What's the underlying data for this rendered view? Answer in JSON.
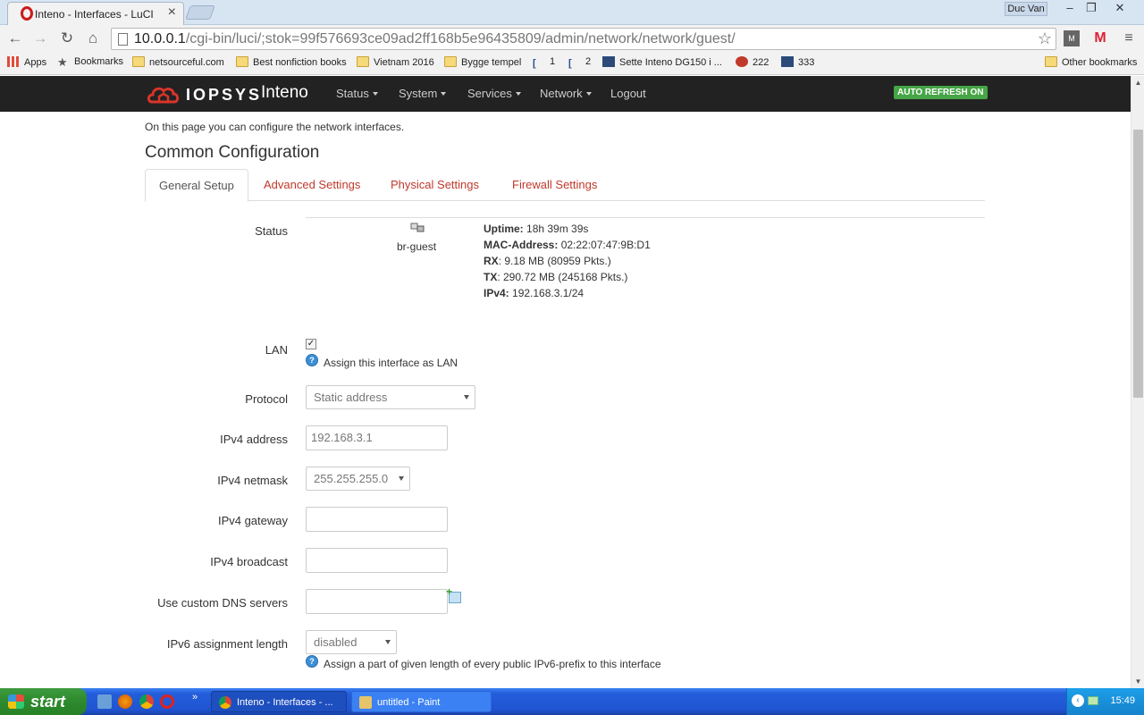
{
  "browser": {
    "tab_title": "Inteno - Interfaces - LuCI",
    "user_name": "Duc Van",
    "url_host": "10.0.0.1",
    "url_path": "/cgi-bin/luci/;stok=99f576693ce09ad2ff168b5e96435809/admin/network/network/guest/",
    "bookmarks": [
      "Apps",
      "Bookmarks",
      "netsourceful.com",
      "Best nonfiction books",
      "Vietnam 2016",
      "Bygge tempel",
      "1",
      "2",
      "Sette Inteno DG150 i ...",
      "222",
      "333"
    ],
    "other_bookmarks": "Other bookmarks"
  },
  "navbar": {
    "brand_logo": "IOPSYS",
    "brand_name": "Inteno",
    "menu": [
      "Status",
      "System",
      "Services",
      "Network",
      "Logout"
    ],
    "auto_refresh": "AUTO REFRESH ON"
  },
  "page": {
    "description": "On this page you can configure the network interfaces.",
    "heading": "Common Configuration",
    "tabs": [
      "General Setup",
      "Advanced Settings",
      "Physical Settings",
      "Firewall Settings"
    ]
  },
  "status": {
    "label": "Status",
    "device": "br-guest",
    "uptime_label": "Uptime:",
    "uptime": "18h 39m 39s",
    "mac_label": "MAC-Address:",
    "mac": "02:22:07:47:9B:D1",
    "rx_label": "RX",
    "rx": ": 9.18 MB (80959 Pkts.)",
    "tx_label": "TX",
    "tx": ": 290.72 MB (245168 Pkts.)",
    "ipv4_label": "IPv4:",
    "ipv4": "192.168.3.1/24"
  },
  "form": {
    "lan_label": "LAN",
    "lan_checked": true,
    "lan_help": "Assign this interface as LAN",
    "protocol_label": "Protocol",
    "protocol_value": "Static address",
    "ipv4_address_label": "IPv4 address",
    "ipv4_address_value": "192.168.3.1",
    "ipv4_netmask_label": "IPv4 netmask",
    "ipv4_netmask_value": "255.255.255.0",
    "ipv4_gateway_label": "IPv4 gateway",
    "ipv4_gateway_value": "",
    "ipv4_broadcast_label": "IPv4 broadcast",
    "ipv4_broadcast_value": "",
    "dns_label": "Use custom DNS servers",
    "dns_value": "",
    "ipv6_assign_label": "IPv6 assignment length",
    "ipv6_assign_value": "disabled",
    "ipv6_assign_help": "Assign a part of given length of every public IPv6-prefix to this interface"
  },
  "taskbar": {
    "start": "start",
    "tasks": [
      "Inteno - Interfaces - ...",
      "untitled - Paint"
    ],
    "clock": "15:49"
  },
  "colors": {
    "navbar_bg": "#222222",
    "tab_link": "#c0392b",
    "badge_green": "#46a546"
  }
}
